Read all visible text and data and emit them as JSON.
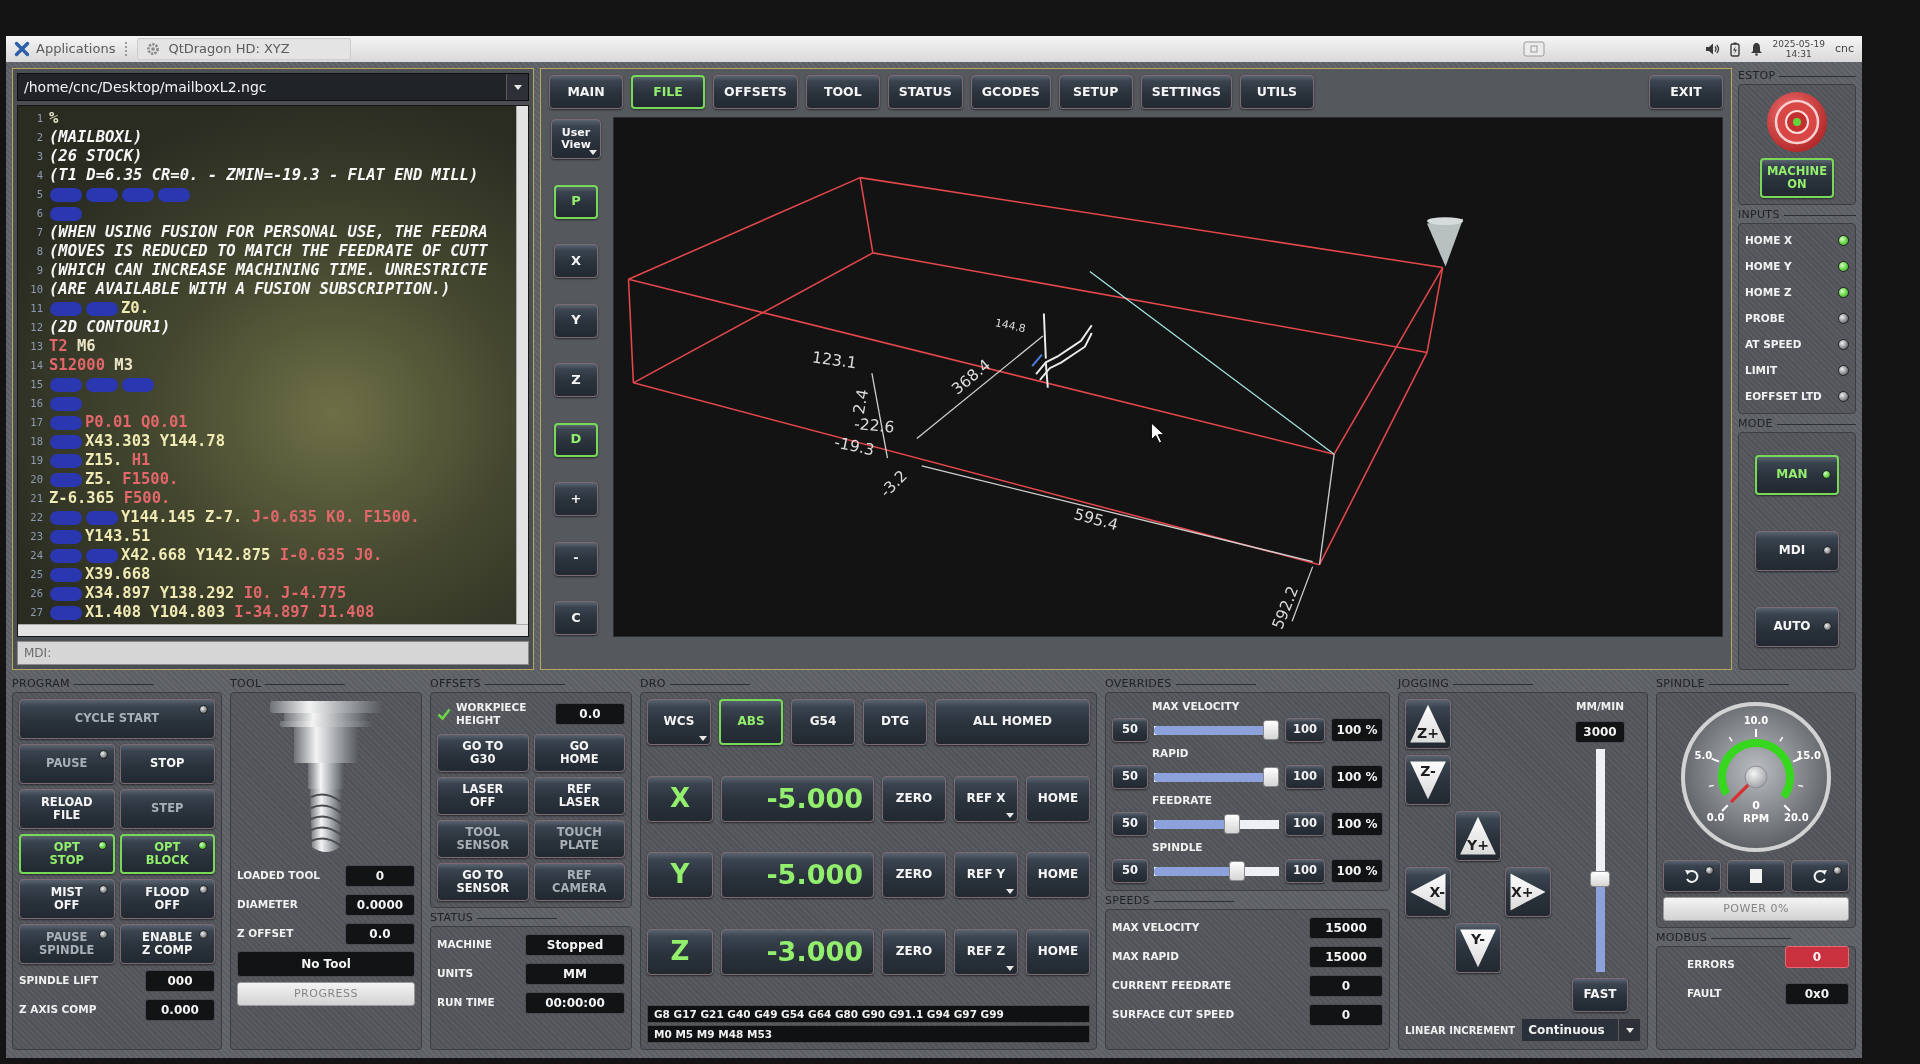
{
  "taskbar": {
    "menu_label": "Applications",
    "window_title": "QtDragon HD: XYZ",
    "date": "2025-05-19",
    "time": "14:31",
    "user": "cnc"
  },
  "file_selector": {
    "path": "/home/cnc/Desktop/mailboxL2.ngc"
  },
  "editor": {
    "lines": [
      {
        "number": "1",
        "tokens": [
          {
            "kind": "word",
            "text": "%"
          }
        ]
      },
      {
        "number": "2",
        "tokens": [
          {
            "kind": "comment",
            "text": "(MAILBOXL)"
          }
        ]
      },
      {
        "number": "3",
        "tokens": [
          {
            "kind": "comment",
            "text": "(26 STOCK)"
          }
        ]
      },
      {
        "number": "4",
        "tokens": [
          {
            "kind": "comment",
            "text": "(T1 D=6.35 CR=0. - ZMIN=-19.3 - FLAT END MILL)"
          }
        ]
      },
      {
        "number": "5",
        "tokens": [
          {
            "kind": "redacted"
          },
          {
            "kind": "redacted"
          },
          {
            "kind": "redacted"
          },
          {
            "kind": "redacted"
          }
        ]
      },
      {
        "number": "6",
        "tokens": [
          {
            "kind": "redacted"
          }
        ]
      },
      {
        "number": "7",
        "tokens": [
          {
            "kind": "comment",
            "text": "(WHEN USING FUSION FOR PERSONAL USE, THE FEEDRA"
          }
        ]
      },
      {
        "number": "8",
        "tokens": [
          {
            "kind": "comment",
            "text": "(MOVES IS REDUCED TO MATCH THE FEEDRATE OF CUTT"
          }
        ]
      },
      {
        "number": "9",
        "tokens": [
          {
            "kind": "comment",
            "text": "(WHICH CAN INCREASE MACHINING TIME. UNRESTRICTE"
          }
        ]
      },
      {
        "number": "10",
        "tokens": [
          {
            "kind": "comment",
            "text": "(ARE AVAILABLE WITH A FUSION SUBSCRIPTION.)"
          }
        ]
      },
      {
        "number": "11",
        "tokens": [
          {
            "kind": "redacted"
          },
          {
            "kind": "redacted"
          },
          {
            "kind": "axis",
            "text": "Z0."
          }
        ]
      },
      {
        "number": "12",
        "tokens": [
          {
            "kind": "comment",
            "text": "(2D CONTOUR1)"
          }
        ]
      },
      {
        "number": "13",
        "tokens": [
          {
            "kind": "param",
            "text": "T2"
          },
          {
            "kind": "word",
            "text": "M6"
          }
        ]
      },
      {
        "number": "14",
        "tokens": [
          {
            "kind": "param",
            "text": "S12000"
          },
          {
            "kind": "word",
            "text": "M3"
          }
        ]
      },
      {
        "number": "15",
        "tokens": [
          {
            "kind": "redacted"
          },
          {
            "kind": "redacted"
          },
          {
            "kind": "redacted"
          }
        ]
      },
      {
        "number": "16",
        "tokens": [
          {
            "kind": "redacted"
          }
        ]
      },
      {
        "number": "17",
        "tokens": [
          {
            "kind": "redacted"
          },
          {
            "kind": "param",
            "text": "P0.01"
          },
          {
            "kind": "param",
            "text": "Q0.01"
          }
        ]
      },
      {
        "number": "18",
        "tokens": [
          {
            "kind": "redacted"
          },
          {
            "kind": "axis",
            "text": "X43.303"
          },
          {
            "kind": "axis",
            "text": "Y144.78"
          }
        ]
      },
      {
        "number": "19",
        "tokens": [
          {
            "kind": "redacted"
          },
          {
            "kind": "axis",
            "text": "Z15."
          },
          {
            "kind": "param",
            "text": "H1"
          }
        ]
      },
      {
        "number": "20",
        "tokens": [
          {
            "kind": "redacted"
          },
          {
            "kind": "axis",
            "text": "Z5."
          },
          {
            "kind": "param",
            "text": "F1500."
          }
        ]
      },
      {
        "number": "21",
        "tokens": [
          {
            "kind": "axis",
            "text": "Z-6.365"
          },
          {
            "kind": "param",
            "text": "F500."
          }
        ]
      },
      {
        "number": "22",
        "tokens": [
          {
            "kind": "redacted"
          },
          {
            "kind": "redacted"
          },
          {
            "kind": "axis",
            "text": "Y144.145"
          },
          {
            "kind": "axis",
            "text": "Z-7."
          },
          {
            "kind": "param",
            "text": "J-0.635"
          },
          {
            "kind": "param",
            "text": "K0."
          },
          {
            "kind": "param",
            "text": "F1500."
          }
        ]
      },
      {
        "number": "23",
        "tokens": [
          {
            "kind": "redacted"
          },
          {
            "kind": "axis",
            "text": "Y143.51"
          }
        ]
      },
      {
        "number": "24",
        "tokens": [
          {
            "kind": "redacted"
          },
          {
            "kind": "redacted"
          },
          {
            "kind": "axis",
            "text": "X42.668"
          },
          {
            "kind": "axis",
            "text": "Y142.875"
          },
          {
            "kind": "param",
            "text": "I-0.635"
          },
          {
            "kind": "param",
            "text": "J0."
          }
        ]
      },
      {
        "number": "25",
        "tokens": [
          {
            "kind": "redacted"
          },
          {
            "kind": "axis",
            "text": "X39.668"
          }
        ]
      },
      {
        "number": "26",
        "tokens": [
          {
            "kind": "redacted"
          },
          {
            "kind": "axis",
            "text": "X34.897"
          },
          {
            "kind": "axis",
            "text": "Y138.292"
          },
          {
            "kind": "param",
            "text": "I0."
          },
          {
            "kind": "param",
            "text": "J-4.775"
          }
        ]
      },
      {
        "number": "27",
        "tokens": [
          {
            "kind": "redacted"
          },
          {
            "kind": "axis",
            "text": "X1.408"
          },
          {
            "kind": "axis",
            "text": "Y104.803"
          },
          {
            "kind": "param",
            "text": "I-34.897"
          },
          {
            "kind": "param",
            "text": "J1.408"
          }
        ]
      }
    ]
  },
  "mdi": {
    "placeholder": "MDI:"
  },
  "tabs": [
    {
      "label": "MAIN",
      "selected": false
    },
    {
      "label": "FILE",
      "selected": true
    },
    {
      "label": "OFFSETS",
      "selected": false
    },
    {
      "label": "TOOL",
      "selected": false
    },
    {
      "label": "STATUS",
      "selected": false
    },
    {
      "label": "GCODES",
      "selected": false
    },
    {
      "label": "SETUP",
      "selected": false
    },
    {
      "label": "SETTINGS",
      "selected": false
    },
    {
      "label": "UTILS",
      "selected": false
    }
  ],
  "exit_button": "EXIT",
  "view_buttons": [
    {
      "label": "User\nView",
      "selected": false,
      "menu": true
    },
    {
      "label": "P",
      "selected": true
    },
    {
      "label": "X",
      "selected": false
    },
    {
      "label": "Y",
      "selected": false
    },
    {
      "label": "Z",
      "selected": false
    },
    {
      "label": "D",
      "selected": true
    },
    {
      "label": "+",
      "selected": false
    },
    {
      "label": "-",
      "selected": false
    },
    {
      "label": "C",
      "selected": false
    }
  ],
  "preview": {
    "dimension_labels": [
      "123.1",
      "2.4",
      "-22.6",
      "-19.3",
      "368.4",
      "144.8",
      "-3.2",
      "595.4",
      "592.2"
    ]
  },
  "estop": {
    "legend": "ESTOP",
    "machine_button": {
      "label": "MACHINE\nON",
      "on": true
    }
  },
  "inputs": {
    "legend": "INPUTS",
    "items": [
      {
        "label": "HOME X",
        "on": true
      },
      {
        "label": "HOME Y",
        "on": true
      },
      {
        "label": "HOME Z",
        "on": true
      },
      {
        "label": "PROBE",
        "on": false
      },
      {
        "label": "AT SPEED",
        "on": false
      },
      {
        "label": "LIMIT",
        "on": false
      },
      {
        "label": "EOFFSET LTD",
        "on": false
      }
    ]
  },
  "mode": {
    "legend": "MODE",
    "items": [
      {
        "label": "MAN",
        "selected": true
      },
      {
        "label": "MDI",
        "selected": false
      },
      {
        "label": "AUTO",
        "selected": false
      }
    ]
  },
  "program": {
    "legend": "PROGRAM",
    "buttons": [
      {
        "label": "CYCLE START",
        "kind": "toggle",
        "checked": false,
        "disabled": true
      },
      {
        "label": "PAUSE",
        "kind": "toggle",
        "checked": false,
        "disabled": true
      },
      {
        "label": "STOP",
        "kind": "push",
        "checked": false,
        "disabled": false
      },
      {
        "label": "RELOAD\nFILE",
        "kind": "push",
        "checked": false,
        "disabled": false
      },
      {
        "label": "STEP",
        "kind": "push",
        "checked": false,
        "disabled": true
      },
      {
        "label": "OPT\nSTOP",
        "kind": "toggle",
        "checked": true,
        "disabled": false
      },
      {
        "label": "OPT\nBLOCK",
        "kind": "toggle",
        "checked": true,
        "disabled": false
      },
      {
        "label": "MIST\nOFF",
        "kind": "toggle",
        "checked": false,
        "disabled": false
      },
      {
        "label": "FLOOD\nOFF",
        "kind": "toggle",
        "checked": false,
        "disabled": false
      },
      {
        "label": "PAUSE\nSPINDLE",
        "kind": "toggle",
        "checked": false,
        "disabled": true
      },
      {
        "label": "ENABLE\nZ COMP",
        "kind": "toggle",
        "checked": false,
        "disabled": false
      }
    ],
    "fields": [
      {
        "label": "SPINDLE LIFT",
        "value": "000"
      },
      {
        "label": "Z AXIS COMP",
        "value": "0.000"
      }
    ]
  },
  "tool": {
    "legend": "TOOL",
    "fields": [
      {
        "label": "LOADED TOOL",
        "value": "0"
      },
      {
        "label": "DIAMETER",
        "value": "0.0000"
      },
      {
        "label": "Z OFFSET",
        "value": "0.0"
      }
    ],
    "tool_name": "No Tool",
    "progress": {
      "label": "PROGRESS",
      "level": 0
    }
  },
  "offsets": {
    "legend": "OFFSETS",
    "workpiece_height": {
      "label": "WORKPIECE\nHEIGHT",
      "checked": true,
      "value": "0.0"
    },
    "buttons": [
      {
        "label": "GO TO\nG30",
        "disabled": false
      },
      {
        "label": "GO\nHOME",
        "disabled": false
      },
      {
        "label": "LASER\nOFF",
        "disabled": false
      },
      {
        "label": "REF\nLASER",
        "disabled": false
      },
      {
        "label": "TOOL\nSENSOR",
        "disabled": true
      },
      {
        "label": "TOUCH\nPLATE",
        "disabled": true
      },
      {
        "label": "GO TO\nSENSOR",
        "disabled": false
      },
      {
        "label": "REF\nCAMERA",
        "disabled": true
      }
    ]
  },
  "status": {
    "legend": "STATUS",
    "fields": [
      {
        "label": "MACHINE",
        "value": "Stopped"
      },
      {
        "label": "UNITS",
        "value": "MM"
      },
      {
        "label": "RUN TIME",
        "value": "00:00:00"
      }
    ]
  },
  "dro": {
    "legend": "DRO",
    "mode_buttons": [
      {
        "label": "WCS",
        "selected": false,
        "menu": true
      },
      {
        "label": "ABS",
        "selected": true
      },
      {
        "label": "G54",
        "selected": false
      },
      {
        "label": "DTG",
        "selected": false
      },
      {
        "label": "ALL HOMED",
        "selected": false
      }
    ],
    "axes": [
      {
        "axis": "X",
        "value": "-5.000",
        "zero": "ZERO",
        "ref": "REF X",
        "home": "HOME"
      },
      {
        "axis": "Y",
        "value": "-5.000",
        "zero": "ZERO",
        "ref": "REF Y",
        "home": "HOME"
      },
      {
        "axis": "Z",
        "value": "-3.000",
        "zero": "ZERO",
        "ref": "REF Z",
        "home": "HOME"
      }
    ],
    "gcodes": "G8 G17 G21 G40 G49 G54 G64 G80 G90 G91.1 G94 G97 G99",
    "mcodes": "M0 M5 M9 M48 M53"
  },
  "overrides": {
    "legend": "OVERRIDES",
    "items": [
      {
        "label": "MAX VELOCITY",
        "min": "50",
        "max": "100",
        "level": 1.0,
        "reading": "100 %"
      },
      {
        "label": "RAPID",
        "min": "50",
        "max": "100",
        "level": 1.0,
        "reading": "100 %"
      },
      {
        "label": "FEEDRATE",
        "min": "50",
        "max": "100",
        "level": 0.64,
        "reading": "100 %"
      },
      {
        "label": "SPINDLE",
        "min": "50",
        "max": "100",
        "level": 0.69,
        "reading": "100 %"
      }
    ]
  },
  "speeds": {
    "legend": "SPEEDS",
    "fields": [
      {
        "label": "MAX VELOCITY",
        "value": "15000"
      },
      {
        "label": "MAX RAPID",
        "value": "15000"
      },
      {
        "label": "CURRENT FEEDRATE",
        "value": "0"
      },
      {
        "label": "SURFACE CUT SPEED",
        "value": "0"
      }
    ]
  },
  "jogging": {
    "legend": "JOGGING",
    "buttons": [
      {
        "label": "Z+",
        "kind": "up"
      },
      {
        "label": "Z-",
        "kind": "down"
      },
      {
        "label": "Y+",
        "kind": "up"
      },
      {
        "label": "X-",
        "kind": "left"
      },
      {
        "label": "X+",
        "kind": "right"
      },
      {
        "label": "Y-",
        "kind": "down"
      }
    ],
    "unit": "MM/MIN",
    "rate": "3000",
    "rate_slider": {
      "level": 0.41
    },
    "fast_button": "FAST",
    "increment_label": "LINEAR INCREMENT",
    "increment": "Continuous"
  },
  "spindle": {
    "legend": "SPINDLE",
    "scale_labels": [
      "0.0",
      "5.0",
      "10.0",
      "15.0",
      "20.0"
    ],
    "reading": "0",
    "unit": "RPM",
    "buttons": [
      {
        "kind": "reverse",
        "on": false
      },
      {
        "kind": "stop"
      },
      {
        "kind": "forward",
        "on": false
      }
    ],
    "power": {
      "label": "POWER 0%",
      "level": 0
    }
  },
  "modbus": {
    "legend": "MODBUS",
    "fields": [
      {
        "label": "ERRORS",
        "value": "0",
        "alert": true
      },
      {
        "label": "FAULT",
        "value": "0x0",
        "alert": false
      }
    ]
  }
}
